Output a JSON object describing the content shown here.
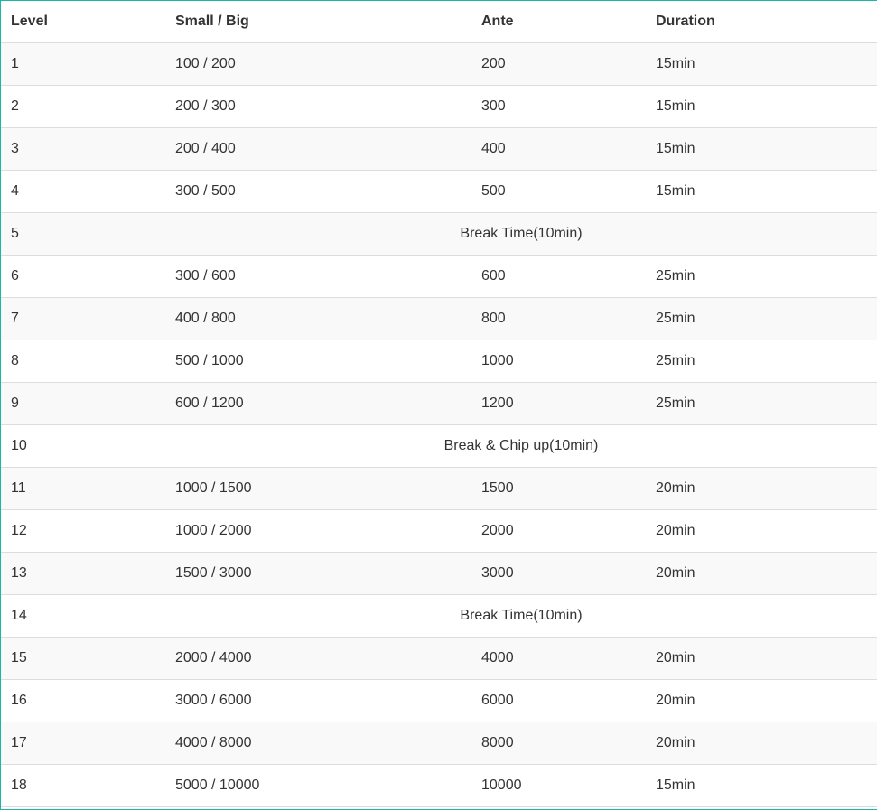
{
  "headers": {
    "level": "Level",
    "blinds": "Small / Big",
    "ante": "Ante",
    "duration": "Duration"
  },
  "rows": [
    {
      "level": "1",
      "blinds": "100 / 200",
      "ante": "200",
      "duration": "15min"
    },
    {
      "level": "2",
      "blinds": "200 / 300",
      "ante": "300",
      "duration": "15min"
    },
    {
      "level": "3",
      "blinds": "200 / 400",
      "ante": "400",
      "duration": "15min"
    },
    {
      "level": "4",
      "blinds": "300 / 500",
      "ante": "500",
      "duration": "15min"
    },
    {
      "level": "5",
      "break": "Break Time(10min)"
    },
    {
      "level": "6",
      "blinds": "300 / 600",
      "ante": "600",
      "duration": "25min"
    },
    {
      "level": "7",
      "blinds": "400 / 800",
      "ante": "800",
      "duration": "25min"
    },
    {
      "level": "8",
      "blinds": "500 / 1000",
      "ante": "1000",
      "duration": "25min"
    },
    {
      "level": "9",
      "blinds": "600 / 1200",
      "ante": "1200",
      "duration": "25min"
    },
    {
      "level": "10",
      "break": "Break & Chip up(10min)"
    },
    {
      "level": "11",
      "blinds": "1000 / 1500",
      "ante": "1500",
      "duration": "20min"
    },
    {
      "level": "12",
      "blinds": "1000 / 2000",
      "ante": "2000",
      "duration": "20min"
    },
    {
      "level": "13",
      "blinds": "1500 / 3000",
      "ante": "3000",
      "duration": "20min"
    },
    {
      "level": "14",
      "break": "Break Time(10min)"
    },
    {
      "level": "15",
      "blinds": "2000 / 4000",
      "ante": "4000",
      "duration": "20min"
    },
    {
      "level": "16",
      "blinds": "3000 / 6000",
      "ante": "6000",
      "duration": "20min"
    },
    {
      "level": "17",
      "blinds": "4000 / 8000",
      "ante": "8000",
      "duration": "20min"
    },
    {
      "level": "18",
      "blinds": "5000 / 10000",
      "ante": "10000",
      "duration": "15min"
    }
  ]
}
